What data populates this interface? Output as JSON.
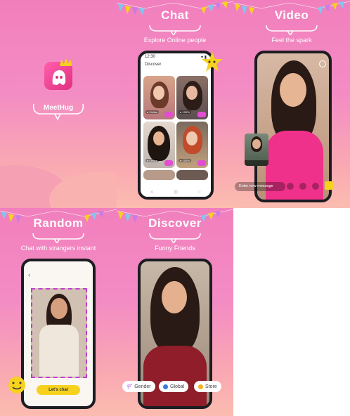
{
  "panels": {
    "logo": {
      "app_name": "MeetHug"
    },
    "chat": {
      "title": "Chat",
      "subtitle": "Explore Online people",
      "phone": {
        "time": "12:30",
        "header": "Discover"
      }
    },
    "video": {
      "title": "Video",
      "subtitle": "Feel the spark",
      "message_placeholder": "Enter new message"
    },
    "random": {
      "title": "Random",
      "subtitle": "Chat with strangers instant",
      "button_label": "Let's chat"
    },
    "discover": {
      "title": "Discover",
      "subtitle": "Funny Friends",
      "filters": [
        "Gender",
        "Global",
        "Store"
      ]
    }
  },
  "colors": {
    "brand_pink": "#f17fbd",
    "accent_yellow": "#f6d21f",
    "accent_magenta": "#e24dd1"
  },
  "icons": [
    "crown-icon",
    "ghost-icon",
    "back-icon",
    "mic-icon",
    "emoji-icon",
    "gift-icon",
    "switch-camera-icon"
  ]
}
